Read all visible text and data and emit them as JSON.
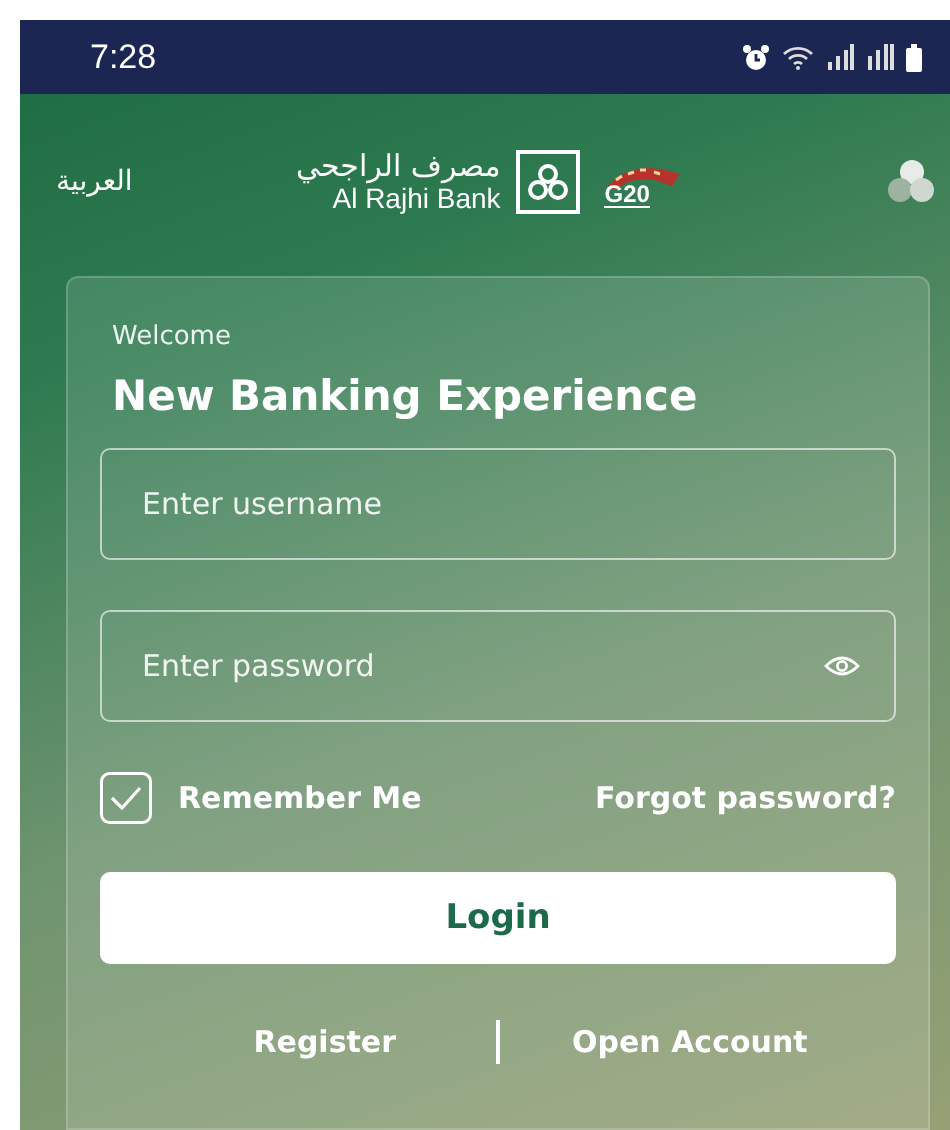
{
  "status_bar": {
    "time": "7:28"
  },
  "header": {
    "language": "العربية",
    "bank_name_ar": "مصرف الراجحي",
    "bank_name_en": "Al Rajhi Bank",
    "event_logo": "G20"
  },
  "card": {
    "greeting": "Welcome",
    "title": "New Banking Experience",
    "fields": [
      {
        "kind": "text",
        "placeholder": "Enter username"
      },
      {
        "kind": "password",
        "placeholder": "Enter password"
      }
    ],
    "remember": {
      "label": "Remember Me",
      "checked": true
    },
    "forgot": "Forgot password?",
    "login": "Login",
    "links": [
      "Register",
      "Open Account"
    ]
  }
}
